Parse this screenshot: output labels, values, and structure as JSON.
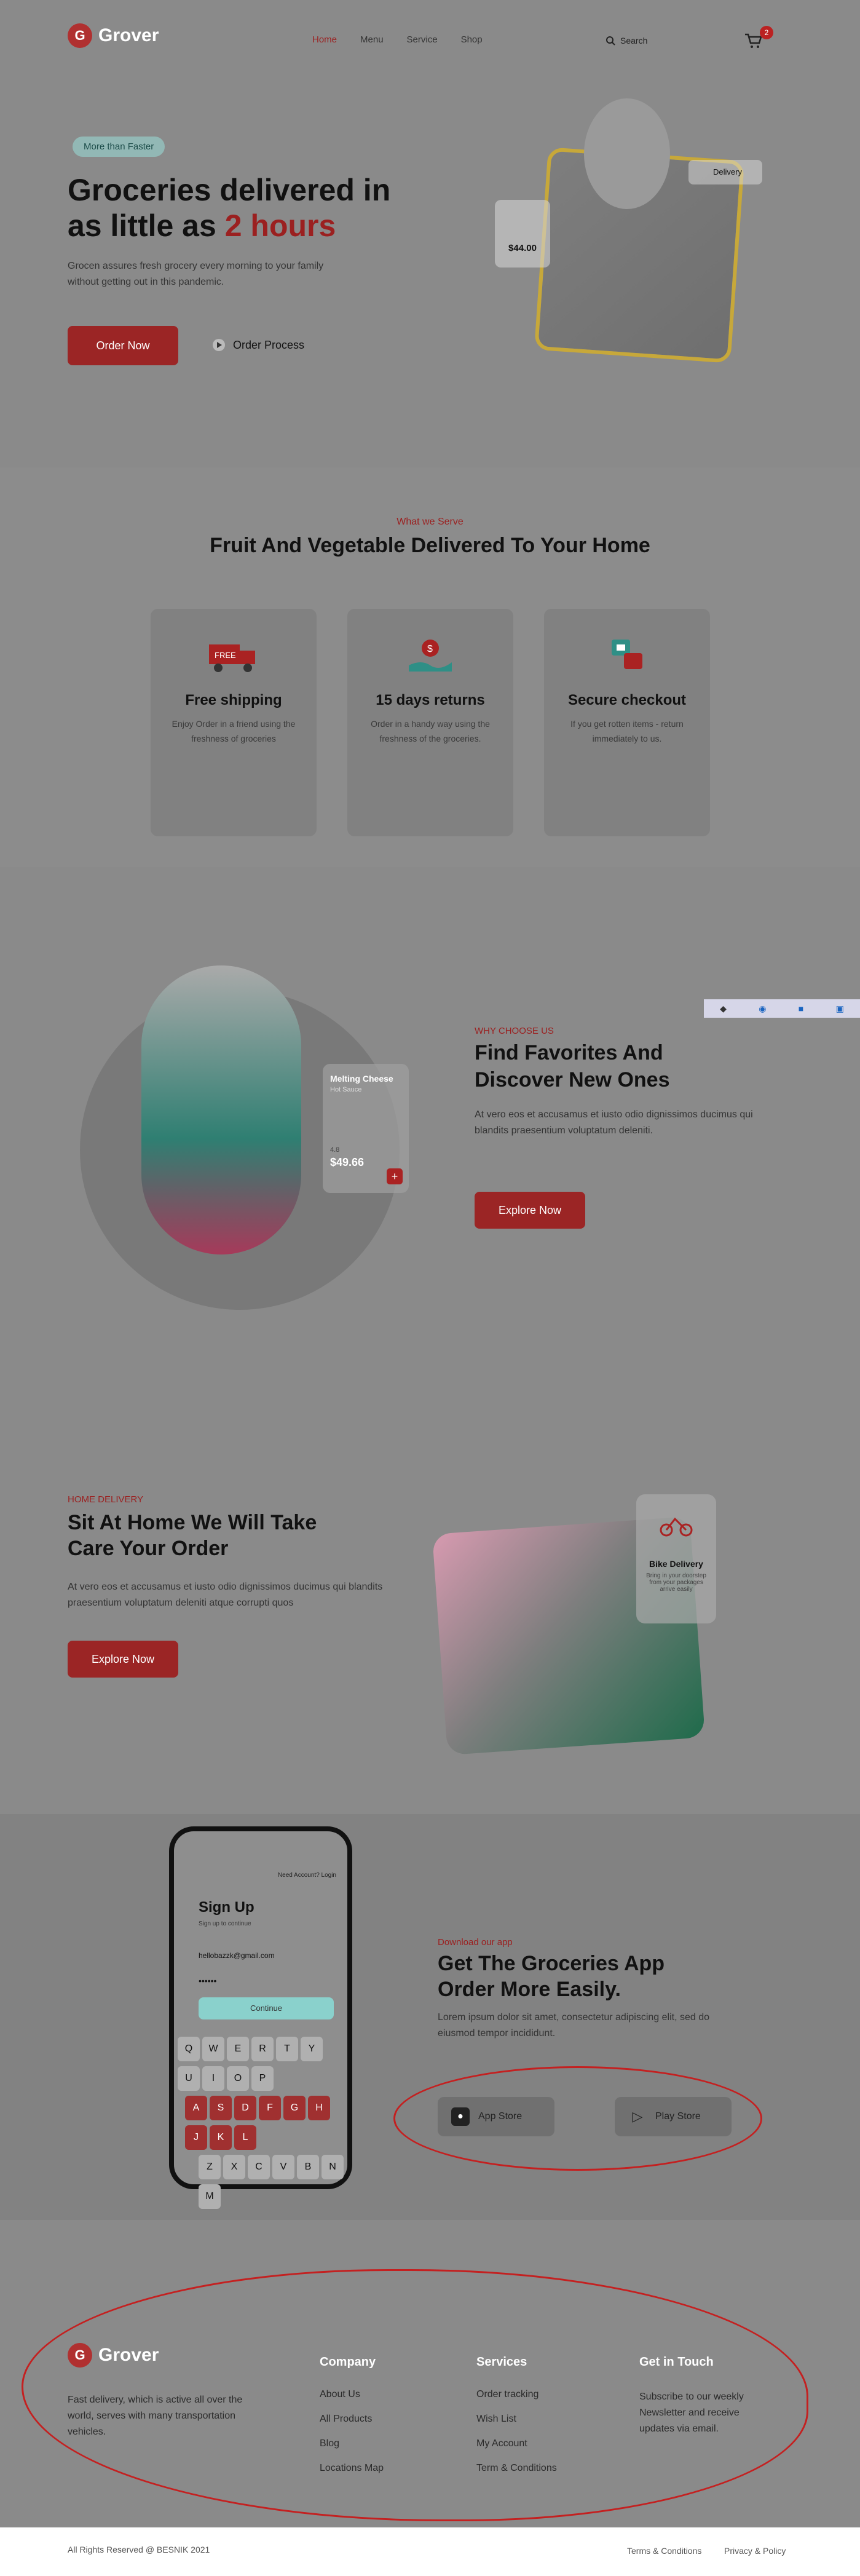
{
  "header": {
    "logo": "Grover",
    "nav": [
      "Home",
      "Menu",
      "Service",
      "Shop"
    ],
    "search_label": "Search",
    "cart_count": "2"
  },
  "hero": {
    "pill": "More than Faster",
    "title_line1": "Groceries delivered in",
    "title_line2_prefix": "as little as ",
    "title_line2_accent": "2 hours",
    "description": "Grocen assures fresh grocery every morning to your family without getting out in this pandemic.",
    "order_now": "Order Now",
    "order_process": "Order Process",
    "delivery_badge": "Delivery",
    "price": "$44.00"
  },
  "services": {
    "eyebrow": "What we Serve",
    "title": "Fruit And Vegetable Delivered To Your Home",
    "cards": [
      {
        "icon": "truck-icon",
        "title": "Free shipping",
        "text": "Enjoy Order in a friend using the freshness of groceries"
      },
      {
        "icon": "money-hand-icon",
        "title": "15 days returns",
        "text": "Order in a handy way using the freshness of the groceries."
      },
      {
        "icon": "secure-checkout-icon",
        "title": "Secure checkout",
        "text": "If you get rotten items - return immediately to us."
      }
    ]
  },
  "favorites": {
    "eyebrow": "WHY CHOOSE US",
    "title_line1": "Find Favorites And",
    "title_line2": "Discover New Ones",
    "description": "At vero eos et accusamus et iusto odio dignissimos ducimus qui blandits praesentium voluptatum deleniti.",
    "button": "Explore Now",
    "product_name": "Melting Cheese",
    "product_sub": "Hot Sauce",
    "product_price": "$49.66",
    "product_rating": "4.8"
  },
  "home_delivery": {
    "eyebrow": "HOME DELIVERY",
    "title_line1": "Sit At Home We Will Take",
    "title_line2": "Care Your Order",
    "description": "At vero eos et accusamus et iusto odio dignissimos ducimus qui blandits praesentium voluptatum deleniti atque corrupti quos",
    "button": "Explore Now",
    "bike_title": "Bike Delivery",
    "bike_text": "Bring in your doorstep from your packages arrive easily"
  },
  "app": {
    "eyebrow": "Download our app",
    "title_line1": "Get The Groceries App",
    "title_line2": "Order More Easily.",
    "description": "Lorem ipsum dolor sit amet, consectetur adipiscing elit, sed do eiusmod tempor incididunt.",
    "app_store": "App Store",
    "play_store": "Play Store",
    "phone_title": "Sign Up",
    "phone_link": "Need Account? Login",
    "phone_subtitle": "Sign up to continue",
    "phone_email": "hellobazzk@gmail.com",
    "phone_password": "••••••",
    "phone_button": "Continue",
    "keys_row1": [
      "Q",
      "W",
      "E",
      "R",
      "T",
      "Y",
      "U",
      "I",
      "O",
      "P"
    ],
    "keys_row2": [
      "A",
      "S",
      "D",
      "F",
      "G",
      "H",
      "J",
      "K",
      "L"
    ],
    "keys_row3": [
      "Z",
      "X",
      "C",
      "V",
      "B",
      "N",
      "M"
    ]
  },
  "footer": {
    "logo": "Grover",
    "about": "Fast delivery, which is active all over the world, serves with many transportation vehicles.",
    "company_title": "Company",
    "company_links": [
      "About Us",
      "All Products",
      "Blog",
      "Locations Map"
    ],
    "services_title": "Services",
    "services_links": [
      "Order tracking",
      "Wish List",
      "My Account",
      "Term & Conditions"
    ],
    "contact_title": "Get in Touch",
    "contact_text": "Subscribe to our weekly Newsletter and receive updates via email.",
    "copyright": "All Rights Reserved @ BESNIK 2021",
    "terms": "Terms & Conditions",
    "privacy": "Privacy & Policy"
  },
  "colors": {
    "accent": "#9b2020",
    "teal": "#8ad1cc",
    "background": "#8a8a8a"
  }
}
